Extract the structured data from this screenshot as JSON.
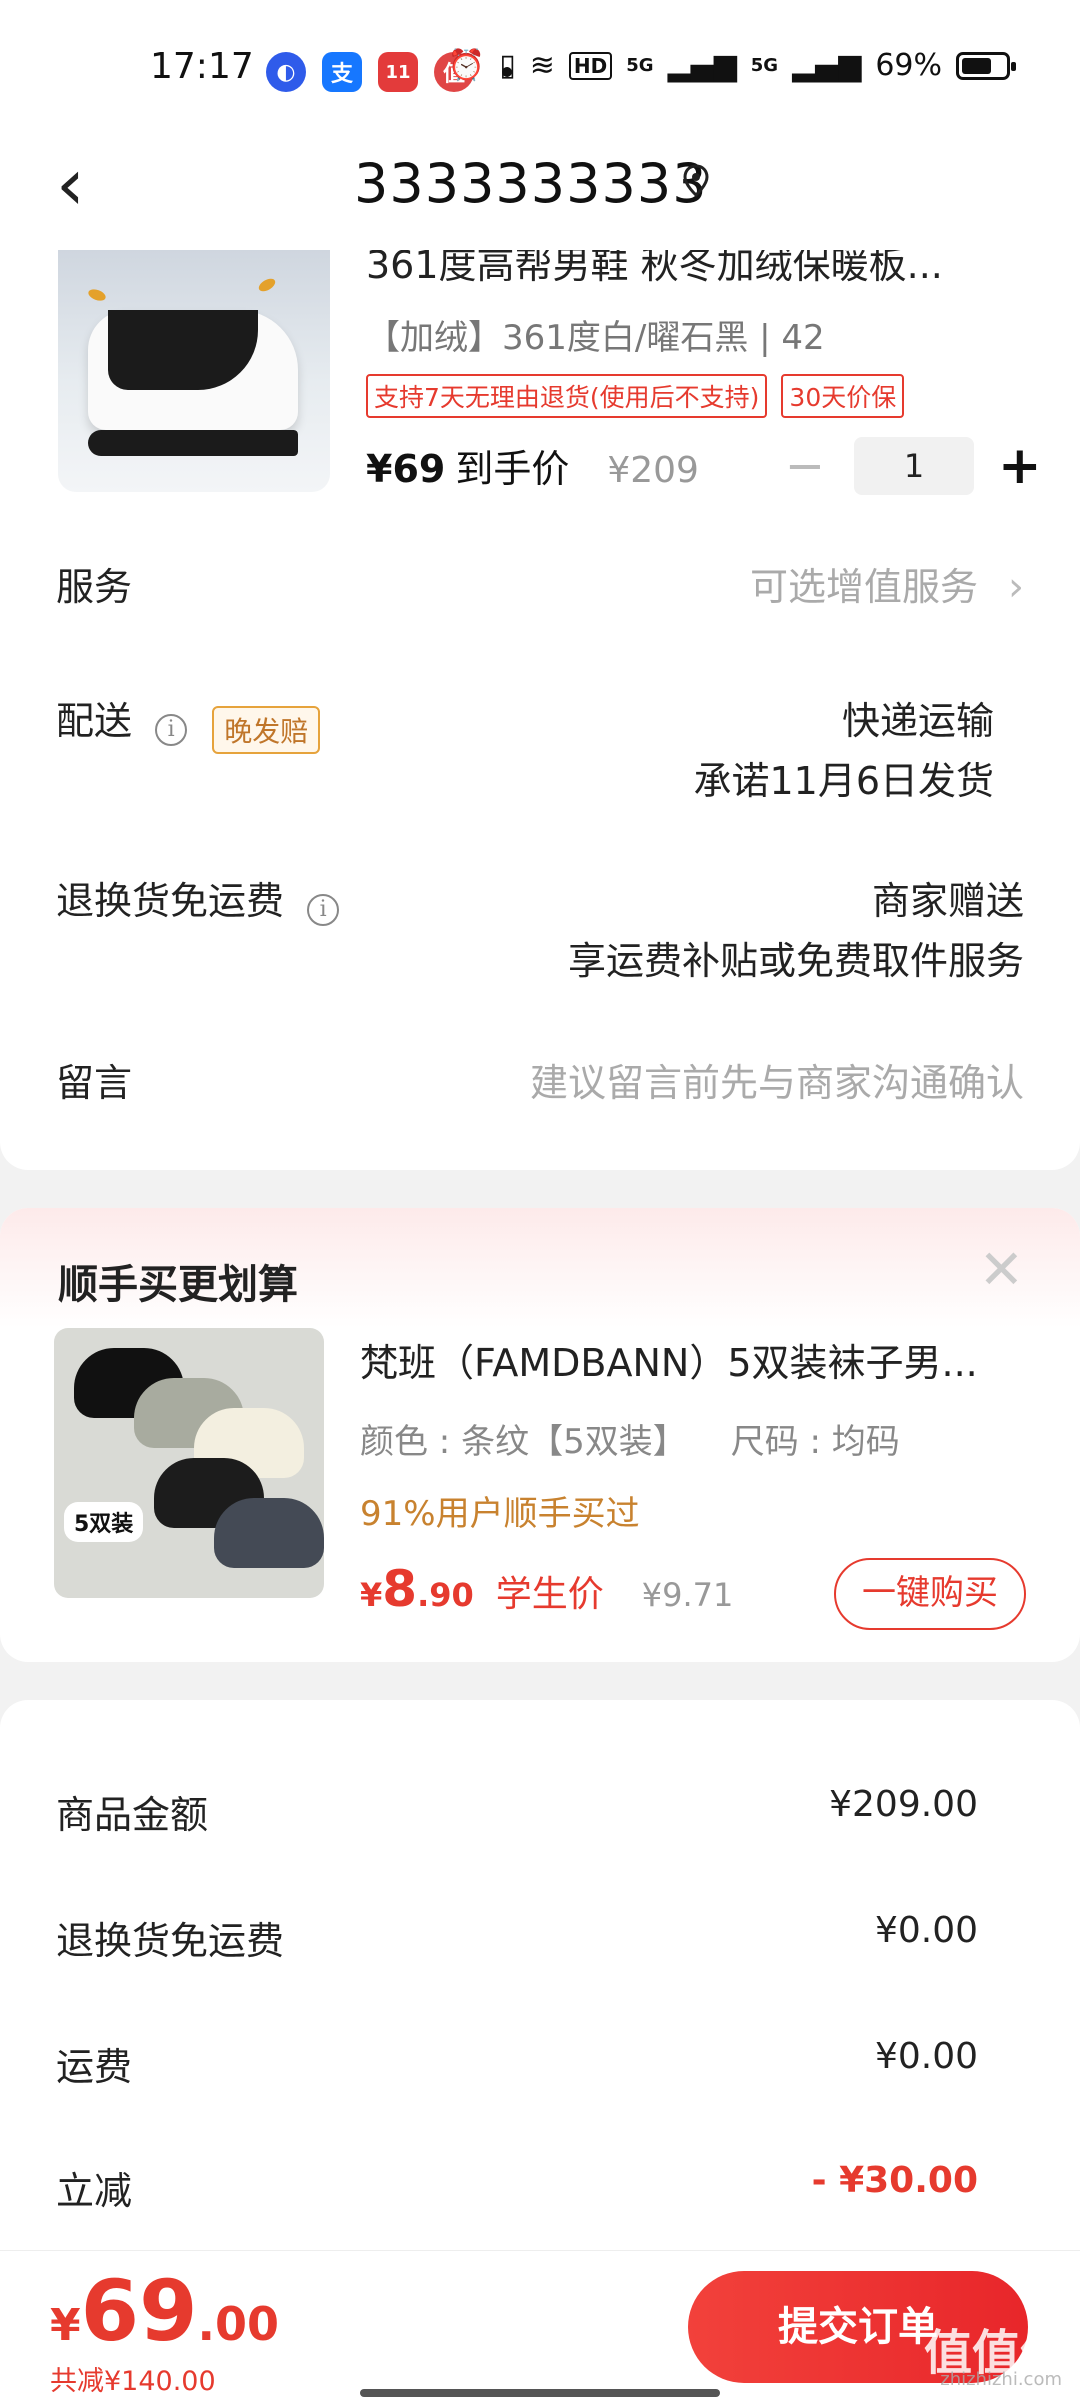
{
  "status_bar": {
    "time": "17:17",
    "battery": "69%",
    "battery_level": 0.69,
    "network_labels": [
      "HD",
      "5G",
      "5G"
    ],
    "apps": [
      {
        "name": "browser-app-icon",
        "glyph": "◐",
        "color": "#2f5bea"
      },
      {
        "name": "alipay-app-icon",
        "glyph": "支",
        "color": "#1677ff"
      },
      {
        "name": "shopping-app-icon",
        "glyph": "11",
        "color": "#e33b3b"
      },
      {
        "name": "zhide-app-icon",
        "glyph": "值",
        "color": "#e04646"
      }
    ]
  },
  "header": {
    "title": "3333333333",
    "back_glyph": "‹"
  },
  "product": {
    "title": "361度高帮男鞋 秋冬加绒保暖板...",
    "spec": "【加绒】361度白/曜石黑 | 42",
    "tags": [
      "支持7天无理由退货(使用后不支持)",
      "30天价保"
    ],
    "price": "¥69",
    "price_label": "到手价",
    "original_price": "¥209",
    "quantity": "1",
    "minus": "−",
    "plus": "+"
  },
  "rows": {
    "service": {
      "label": "服务",
      "value": "可选增值服务",
      "chevron": "›"
    },
    "delivery": {
      "label": "配送",
      "badge": "晚发赔",
      "value1": "快递运输",
      "value2": "承诺11月6日发货"
    },
    "return_free": {
      "label": "退换货免运费",
      "value1": "商家赠送",
      "value2": "享运费补贴或免费取件服务"
    },
    "message": {
      "label": "留言",
      "placeholder": "建议留言前先与商家沟通确认"
    }
  },
  "addon": {
    "section_title": "顺手买更划算",
    "close": "✕",
    "title": "梵班（FAMDBANN）5双装袜子男...",
    "color_spec": "颜色 : 条纹【5双装】",
    "size_spec": "尺码 : 均码",
    "buyers": "91%用户顺手买过",
    "price_currency": "¥",
    "price_int": "8",
    "price_dec": ".90",
    "price_label": "学生价",
    "original_price": "¥9.71",
    "buy_label": "一键购买",
    "image_badge": "5双装"
  },
  "summary": [
    {
      "label": "商品金额",
      "value": "¥209.00",
      "highlight": false
    },
    {
      "label": "退换货免运费",
      "value": "¥0.00",
      "highlight": false
    },
    {
      "label": "运费",
      "value": "¥0.00",
      "highlight": false
    },
    {
      "label": "立减",
      "value": "- ¥30.00",
      "highlight": true
    }
  ],
  "bottom": {
    "currency": "¥",
    "total_int": "69",
    "total_dec": ".00",
    "saved": "共减¥140.00",
    "submit": "提交订单",
    "watermark": "值值值",
    "watermark_sub": "zhizhizhi.com"
  },
  "colors": {
    "accent": "#e63a2e",
    "orange": "#c8822f"
  }
}
